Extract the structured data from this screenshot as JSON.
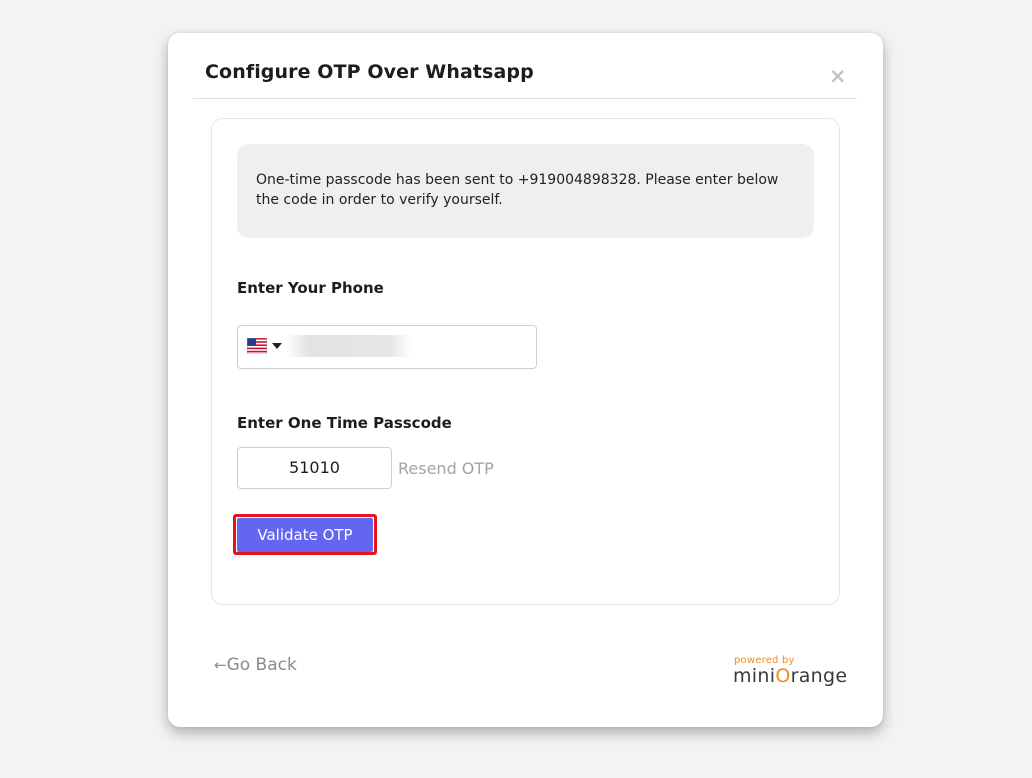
{
  "modal": {
    "title": "Configure OTP Over Whatsapp",
    "close_icon": "×"
  },
  "info": {
    "message": "One-time passcode has been sent to +919004898328. Please enter below the code in order to verify yourself."
  },
  "phone": {
    "label": "Enter Your Phone",
    "country_flag": "us-flag-icon",
    "value_redacted": true
  },
  "otp": {
    "label": "Enter One Time Passcode",
    "value": "51010",
    "resend_label": "Resend OTP"
  },
  "actions": {
    "validate_label": "Validate OTP",
    "validate_color": "#6366f1",
    "highlight_color": "#e4141c"
  },
  "footer": {
    "back_arrow": "←",
    "back_label": "Go Back",
    "brand_powered": "powered by",
    "brand_name_prefix": "mini",
    "brand_name_mark": "O",
    "brand_name_suffix": "range",
    "brand_color": "#f28b22"
  }
}
